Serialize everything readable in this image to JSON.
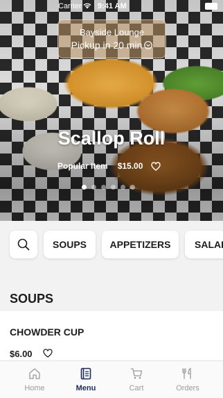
{
  "status_bar": {
    "carrier": "Carrier",
    "time": "9:41 AM"
  },
  "location": {
    "name": "Bayside Lounge",
    "pickup": "Pickup in 20 min"
  },
  "featured": {
    "title": "Scallop Roll",
    "tag": "Popular Item",
    "price": "$15.00",
    "slides": 6,
    "active_slide": 1
  },
  "categories": [
    "SOUPS",
    "APPETIZERS",
    "SALADS"
  ],
  "section": {
    "title": "SOUPS"
  },
  "items": [
    {
      "name": "CHOWDER CUP",
      "price": "$6.00"
    }
  ],
  "tabs": [
    {
      "label": "Home",
      "icon": "home-icon"
    },
    {
      "label": "Menu",
      "icon": "menu-book-icon",
      "active": true
    },
    {
      "label": "Cart",
      "icon": "cart-icon"
    },
    {
      "label": "Orders",
      "icon": "utensils-icon"
    }
  ],
  "colors": {
    "accent": "#1f2a5c",
    "tab_inactive": "#9a9a9a"
  }
}
